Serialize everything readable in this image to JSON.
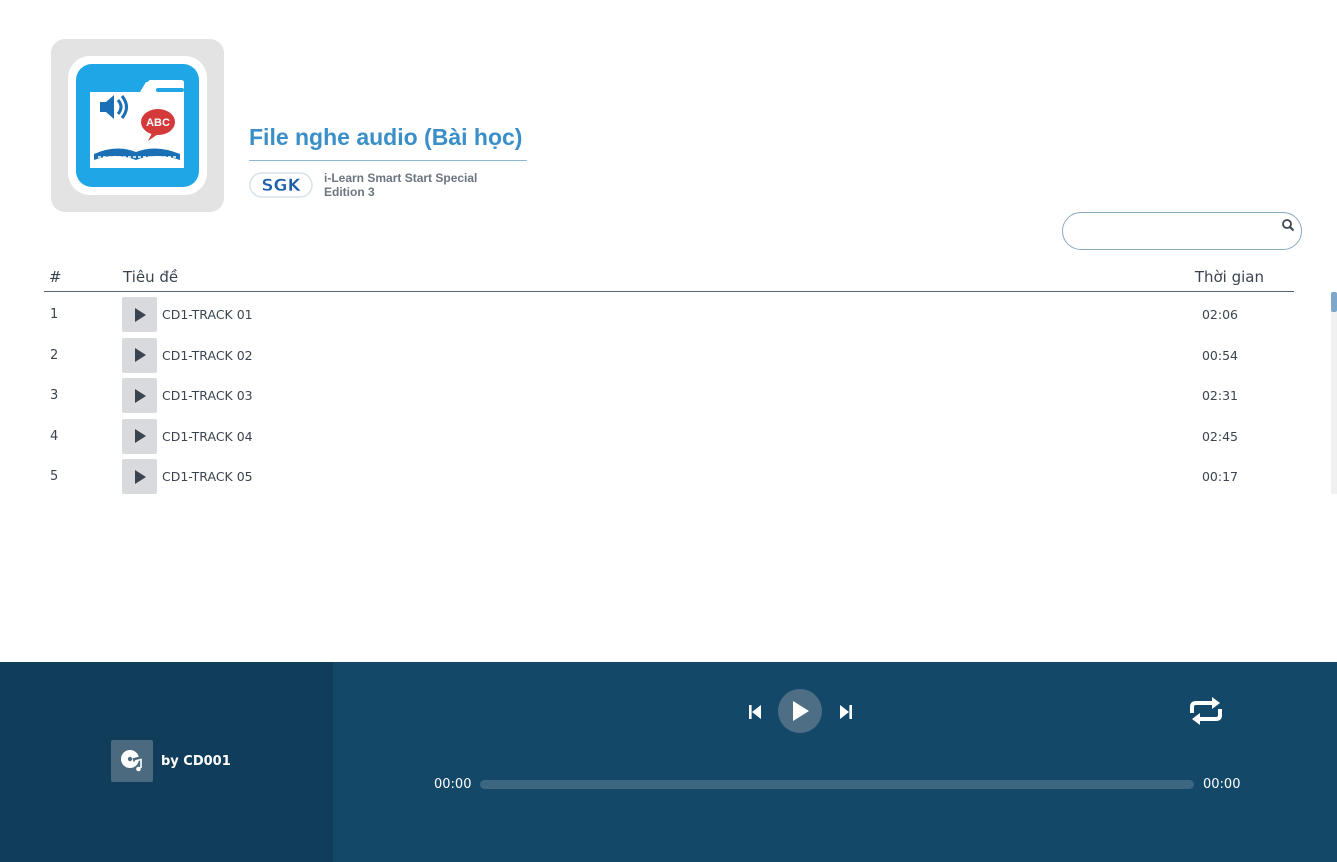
{
  "header": {
    "title": "File nghe audio (Bài học)",
    "publisher_badge": "SGK",
    "book_name": "i-Learn Smart Start Special Edition 3",
    "cover_icon": "audio-book-icon",
    "cover_badge_text": "ABC"
  },
  "search": {
    "placeholder": "",
    "value": "",
    "icon": "search-icon"
  },
  "table": {
    "columns": [
      "#",
      "Tiêu đề",
      "Thời gian"
    ],
    "rows": [
      {
        "num": "1",
        "title": "CD1-TRACK 01",
        "time": "02:06"
      },
      {
        "num": "2",
        "title": "CD1-TRACK 02",
        "time": "00:54"
      },
      {
        "num": "3",
        "title": "CD1-TRACK 03",
        "time": "02:31"
      },
      {
        "num": "4",
        "title": "CD1-TRACK 04",
        "time": "02:45"
      },
      {
        "num": "5",
        "title": "CD1-TRACK 05",
        "time": "00:17"
      }
    ]
  },
  "player": {
    "artist": "by CD001",
    "current_time": "00:00",
    "total_time": "00:00",
    "progress_fraction": 0,
    "icons": {
      "track": "music-disc-icon",
      "prev": "skip-previous-icon",
      "play": "play-icon",
      "next": "skip-next-icon",
      "repeat": "repeat-icon"
    }
  },
  "colors": {
    "title": "#3a8fc8",
    "player_bg": "#134868",
    "player_left_bg": "#0f3d5a"
  }
}
